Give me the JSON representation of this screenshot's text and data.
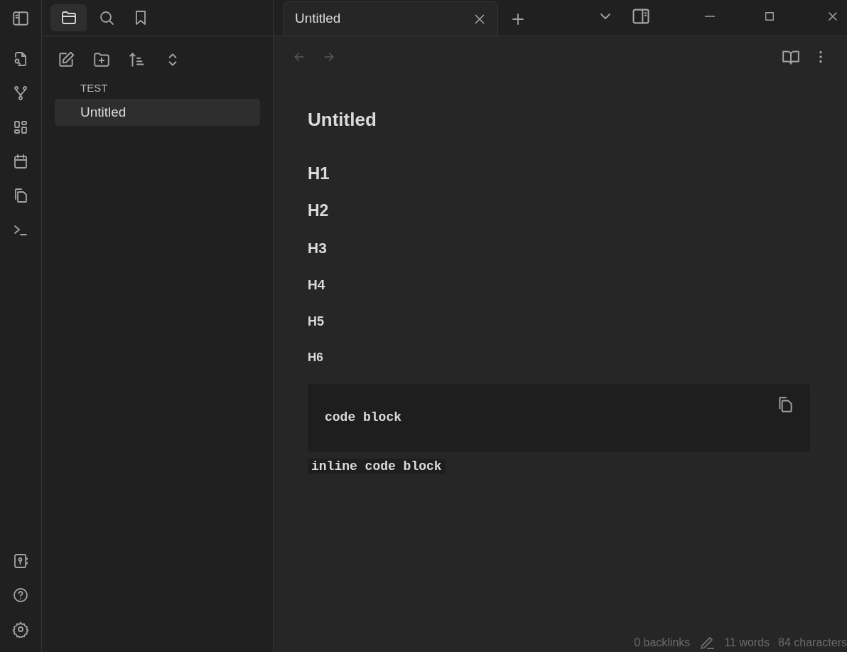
{
  "sidebar_tabs": [
    {
      "kind": "files",
      "selected": true
    },
    {
      "kind": "search",
      "selected": false
    },
    {
      "kind": "bookmarks",
      "selected": false
    }
  ],
  "file_explorer": {
    "vault": "TEST",
    "files": [
      {
        "name": "Untitled",
        "selected": true
      }
    ]
  },
  "tabs": [
    {
      "title": "Untitled",
      "selected": true
    }
  ],
  "note": {
    "title": "Untitled",
    "blocks": [
      {
        "kind": "h1",
        "text": "H1"
      },
      {
        "kind": "h2",
        "text": "H2"
      },
      {
        "kind": "h3",
        "text": "H3"
      },
      {
        "kind": "h4",
        "text": "H4"
      },
      {
        "kind": "h5",
        "text": "H5"
      },
      {
        "kind": "h6",
        "text": "H6"
      },
      {
        "kind": "code",
        "text": "code block"
      },
      {
        "kind": "inline_code",
        "text": "inline code block"
      }
    ]
  },
  "status_bar": {
    "backlinks": "0 backlinks",
    "words": "11 words",
    "characters": "84 characters"
  }
}
